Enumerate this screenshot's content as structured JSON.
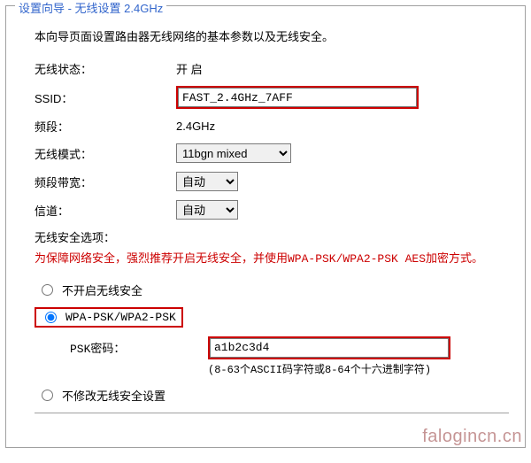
{
  "panel": {
    "title": "设置向导 - 无线设置 2.4GHz",
    "description": "本向导页面设置路由器无线网络的基本参数以及无线安全。"
  },
  "fields": {
    "status_label": "无线状态：",
    "status_value": "开 启",
    "ssid_label": "SSID：",
    "ssid_value": "FAST_2.4GHz_7AFF",
    "band_label": "频段：",
    "band_value": "2.4GHz",
    "mode_label": "无线模式：",
    "mode_value": "11bgn mixed",
    "bandwidth_label": "频段带宽：",
    "bandwidth_value": "自动",
    "channel_label": "信道：",
    "channel_value": "自动"
  },
  "security": {
    "heading": "无线安全选项：",
    "warning": "为保障网络安全，强烈推荐开启无线安全，并使用WPA-PSK/WPA2-PSK AES加密方式。",
    "option_none": "不开启无线安全",
    "option_wpa": "WPA-PSK/WPA2-PSK",
    "psk_label": "PSK密码：",
    "psk_value": "a1b2c3d4",
    "psk_hint": "(8-63个ASCII码字符或8-64个十六进制字符)",
    "option_unchanged": "不修改无线安全设置"
  },
  "watermark": "falogincn.cn"
}
